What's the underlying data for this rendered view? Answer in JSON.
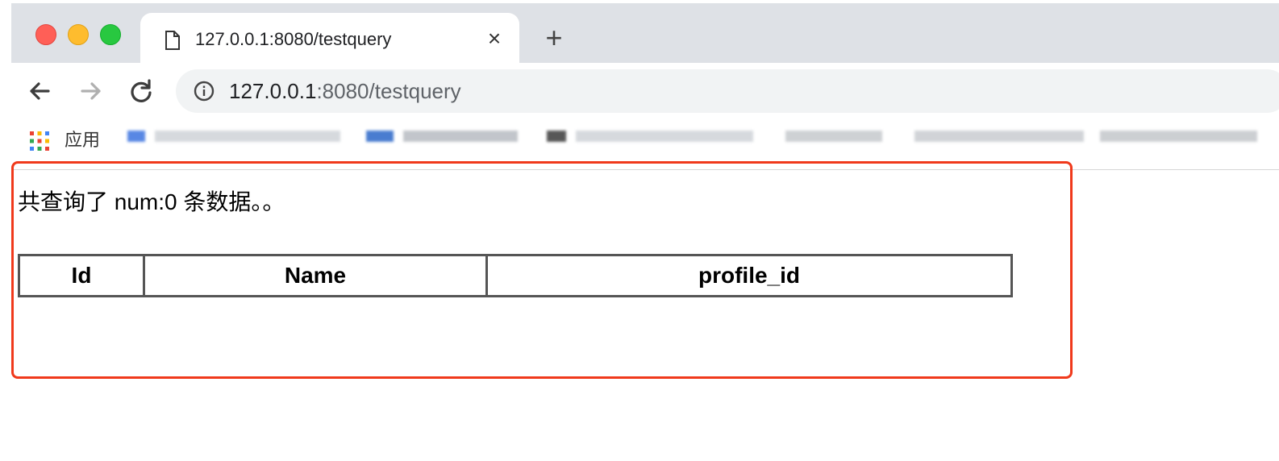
{
  "browser": {
    "tab": {
      "title": "127.0.0.1:8080/testquery",
      "close_glyph": "×",
      "icon": "document-icon"
    },
    "new_tab_glyph": "+",
    "address_bar": {
      "host": "127.0.0.1",
      "path": ":8080/testquery",
      "icon": "info-icon"
    },
    "bookmarks": {
      "apps_label": "应用"
    }
  },
  "page": {
    "summary": "共查询了 num:0 条数据。。",
    "table": {
      "headers": [
        "Id",
        "Name",
        "profile_id"
      ]
    }
  },
  "colors": {
    "highlight_border": "#f0391b",
    "tabstrip": "#dee1e6",
    "omnibox": "#f1f3f4"
  }
}
